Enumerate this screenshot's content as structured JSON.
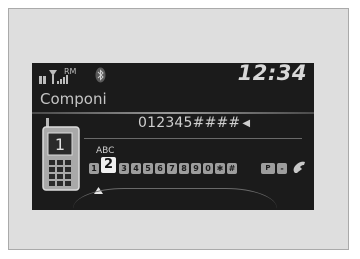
{
  "status": {
    "clock": "12:34",
    "roaming_label": "RM"
  },
  "screen_title": "Componi",
  "phone_line": "1",
  "number": {
    "value": "012345####",
    "caret": "◀"
  },
  "keypad": {
    "selected_letters": "ABC",
    "keys": [
      "1",
      "2",
      "3",
      "4",
      "5",
      "6",
      "7",
      "8",
      "9",
      "0",
      "✱",
      "#",
      "P",
      "-"
    ],
    "selected_index": 1,
    "end_icon": "handset-icon"
  }
}
